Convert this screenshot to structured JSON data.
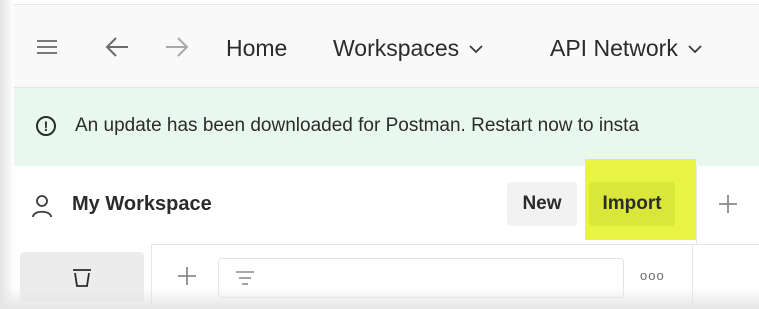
{
  "nav": {
    "home": "Home",
    "workspaces": "Workspaces",
    "api_network": "API Network",
    "chevron": "∨"
  },
  "banner": {
    "text": "An update has been downloaded for Postman. Restart now to insta",
    "icon_glyph": "!"
  },
  "workspace": {
    "title": "My Workspace",
    "new_label": "New",
    "import_label": "Import"
  },
  "toolbar": {
    "more_label": "ooo"
  },
  "icons": {
    "menu": "menu-icon",
    "back": "back-arrow-icon",
    "forward": "forward-arrow-icon",
    "warning": "info-circle-icon",
    "user": "user-icon",
    "new_tab": "plus-icon",
    "trash": "trash-icon",
    "add": "plus-icon",
    "filter": "filter-icon",
    "more": "more-horizontal-icon"
  },
  "colors": {
    "banner_bg": "#e9f8ef",
    "highlight": "#e8f443",
    "import_button": "#d9e73a",
    "topbar_bg": "#f9f9f9"
  }
}
